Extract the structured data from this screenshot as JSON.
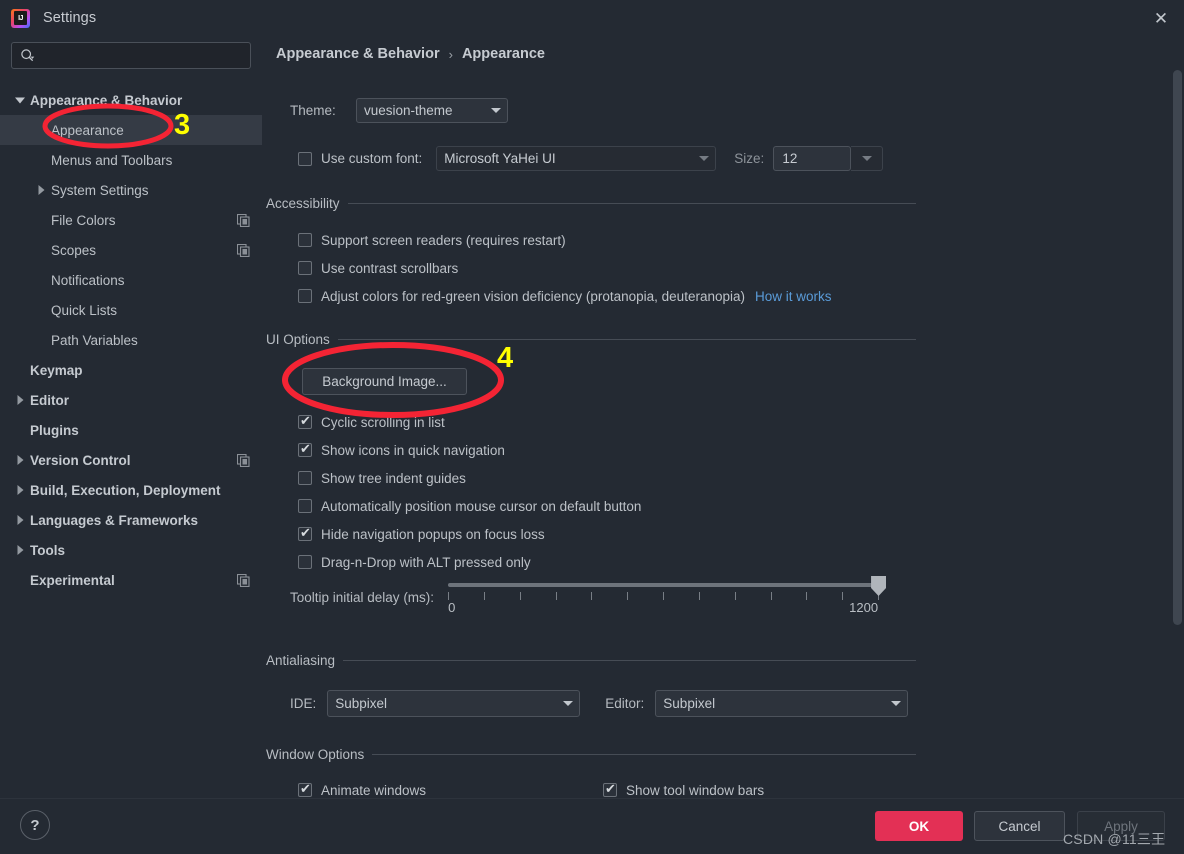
{
  "window": {
    "title": "Settings",
    "logo_icon": "intellij-idea-logo",
    "close_icon": "close-icon"
  },
  "sidebar": {
    "search": {
      "placeholder": "",
      "value": "",
      "icon": "search-icon"
    },
    "items": [
      {
        "label": "Appearance & Behavior",
        "level": 0,
        "bold": true,
        "twisty": "expanded",
        "selected": false,
        "copy": false
      },
      {
        "label": "Appearance",
        "level": 1,
        "bold": false,
        "twisty": "none",
        "selected": true,
        "copy": false
      },
      {
        "label": "Menus and Toolbars",
        "level": 1,
        "bold": false,
        "twisty": "none",
        "selected": false,
        "copy": false
      },
      {
        "label": "System Settings",
        "level": 1,
        "bold": false,
        "twisty": "collapsed",
        "selected": false,
        "copy": false
      },
      {
        "label": "File Colors",
        "level": 1,
        "bold": false,
        "twisty": "none",
        "selected": false,
        "copy": true
      },
      {
        "label": "Scopes",
        "level": 1,
        "bold": false,
        "twisty": "none",
        "selected": false,
        "copy": true
      },
      {
        "label": "Notifications",
        "level": 1,
        "bold": false,
        "twisty": "none",
        "selected": false,
        "copy": false
      },
      {
        "label": "Quick Lists",
        "level": 1,
        "bold": false,
        "twisty": "none",
        "selected": false,
        "copy": false
      },
      {
        "label": "Path Variables",
        "level": 1,
        "bold": false,
        "twisty": "none",
        "selected": false,
        "copy": false
      },
      {
        "label": "Keymap",
        "level": 0,
        "bold": true,
        "twisty": "none",
        "selected": false,
        "copy": false
      },
      {
        "label": "Editor",
        "level": 0,
        "bold": true,
        "twisty": "collapsed",
        "selected": false,
        "copy": false
      },
      {
        "label": "Plugins",
        "level": 0,
        "bold": true,
        "twisty": "none",
        "selected": false,
        "copy": false
      },
      {
        "label": "Version Control",
        "level": 0,
        "bold": true,
        "twisty": "collapsed",
        "selected": false,
        "copy": true
      },
      {
        "label": "Build, Execution, Deployment",
        "level": 0,
        "bold": true,
        "twisty": "collapsed",
        "selected": false,
        "copy": false
      },
      {
        "label": "Languages & Frameworks",
        "level": 0,
        "bold": true,
        "twisty": "collapsed",
        "selected": false,
        "copy": false
      },
      {
        "label": "Tools",
        "level": 0,
        "bold": true,
        "twisty": "collapsed",
        "selected": false,
        "copy": false
      },
      {
        "label": "Experimental",
        "level": 0,
        "bold": true,
        "twisty": "none",
        "selected": false,
        "copy": true
      }
    ]
  },
  "breadcrumb": {
    "root": "Appearance & Behavior",
    "separator": "›",
    "leaf": "Appearance"
  },
  "appearance": {
    "theme_label": "Theme:",
    "theme_value": "vuesion-theme",
    "custom_font_label": "Use custom font:",
    "custom_font_checked": false,
    "custom_font_value": "Microsoft YaHei UI",
    "size_label": "Size:",
    "size_value": "12"
  },
  "accessibility": {
    "title": "Accessibility",
    "options": [
      {
        "label": "Support screen readers (requires restart)",
        "checked": false
      },
      {
        "label": "Use contrast scrollbars",
        "checked": false
      },
      {
        "label": "Adjust colors for red-green vision deficiency (protanopia, deuteranopia)",
        "checked": false,
        "link": "How it works"
      }
    ]
  },
  "ui_options": {
    "title": "UI Options",
    "background_image_button": "Background Image...",
    "options": [
      {
        "label": "Cyclic scrolling in list",
        "checked": true
      },
      {
        "label": "Show icons in quick navigation",
        "checked": true
      },
      {
        "label": "Show tree indent guides",
        "checked": false
      },
      {
        "label": "Automatically position mouse cursor on default button",
        "checked": false
      },
      {
        "label": "Hide navigation popups on focus loss",
        "checked": true
      },
      {
        "label": "Drag-n-Drop with ALT pressed only",
        "checked": false
      }
    ],
    "tooltip_delay_label": "Tooltip initial delay (ms):",
    "tooltip_delay_min": "0",
    "tooltip_delay_max": "1200",
    "tooltip_delay_value": 1200
  },
  "antialiasing": {
    "title": "Antialiasing",
    "ide_label": "IDE:",
    "ide_value": "Subpixel",
    "editor_label": "Editor:",
    "editor_value": "Subpixel"
  },
  "window_options": {
    "title": "Window Options",
    "options": [
      {
        "label": "Animate windows",
        "checked": true
      },
      {
        "label": "Show tool window bars",
        "checked": true
      }
    ]
  },
  "footer": {
    "help_label": "?",
    "ok_label": "OK",
    "cancel_label": "Cancel",
    "apply_label": "Apply",
    "watermark": "CSDN @11三王"
  },
  "annotations": [
    {
      "number": "3",
      "target": "sidebar-item-appearance"
    },
    {
      "number": "4",
      "target": "background-image-button"
    }
  ],
  "colors": {
    "window_bg": "#242a33",
    "selection_bg": "#353b45",
    "accent_ok": "#e33055",
    "link": "#5a9bd8",
    "annotation_circle": "#f42434",
    "annotation_number": "#ffff00"
  }
}
